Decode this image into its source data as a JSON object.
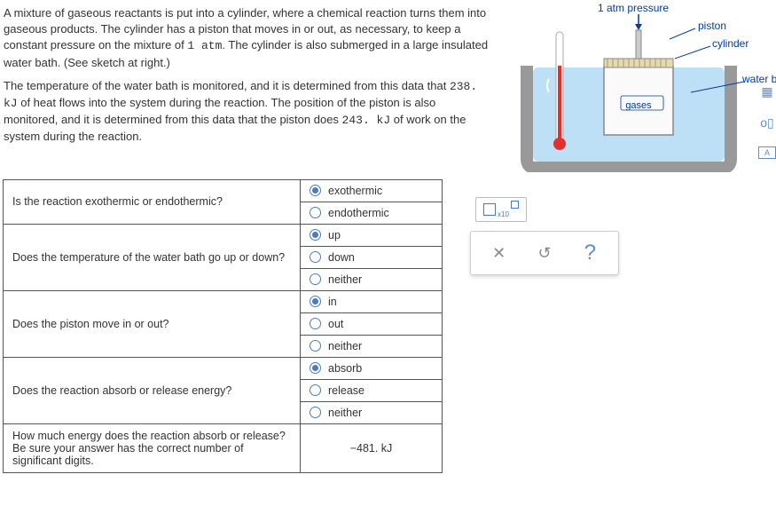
{
  "problem": {
    "para1_a": "A mixture of gaseous reactants is put into a cylinder, where a chemical reaction turns them into gaseous products. The cylinder has a piston that moves in or out, as necessary, to keep a constant pressure on the mixture of ",
    "val1": "1 atm",
    "para1_b": ". The cylinder is also submerged in a large insulated water bath. (See sketch at right.)",
    "para2_a": "The temperature of the water bath is monitored, and it is determined from this data that ",
    "val2": "238. kJ",
    "para2_b": " of heat flows into the system during the reaction. The position of the piston is also monitored, and it is determined from this data that the piston does ",
    "val3": "243. kJ",
    "para2_c": " of work on the system during the reaction."
  },
  "diagram": {
    "pressure": "1 atm pressure",
    "piston": "piston",
    "cylinder": "cylinder",
    "waterbath": "water bath",
    "gases": "gases"
  },
  "questions": {
    "q1": "Is the reaction exothermic or endothermic?",
    "q2": "Does the temperature of the water bath go up or down?",
    "q3": "Does the piston move in or out?",
    "q4": "Does the reaction absorb or release energy?",
    "q5": "How much energy does the reaction absorb or release? Be sure your answer has the correct number of significant digits."
  },
  "options": {
    "exothermic": "exothermic",
    "endothermic": "endothermic",
    "up": "up",
    "down": "down",
    "neither": "neither",
    "in": "in",
    "out": "out",
    "absorb": "absorb",
    "release": "release"
  },
  "answer_energy": "−481. kJ",
  "toolbox": {
    "x10": "x10",
    "clear": "✕",
    "reset": "↺",
    "help": "?"
  }
}
